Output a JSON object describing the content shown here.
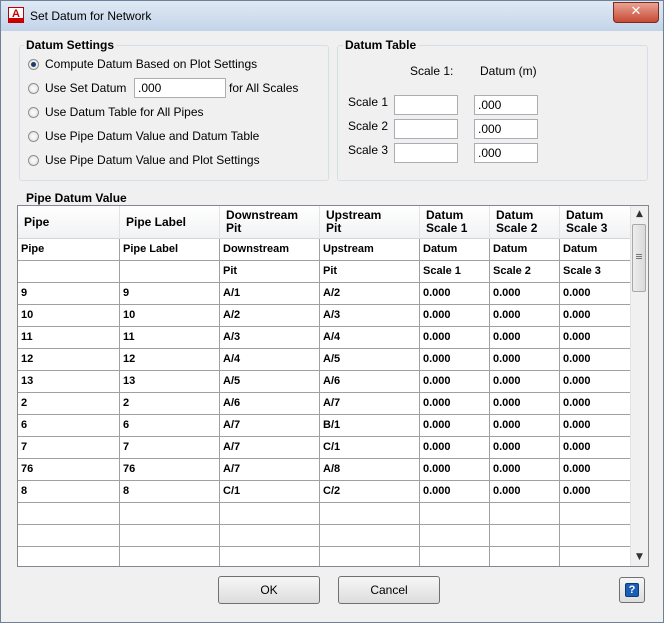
{
  "window": {
    "title": "Set Datum for Network",
    "app_icon_letter": "A",
    "close_glyph": "✕"
  },
  "datum_settings": {
    "title": "Datum Settings",
    "options": [
      {
        "label": "Compute Datum Based on Plot Settings",
        "checked": true
      },
      {
        "label": "Use Set Datum",
        "checked": false
      },
      {
        "label": "Use Datum Table for All Pipes",
        "checked": false
      },
      {
        "label": "Use Pipe Datum Value and Datum Table",
        "checked": false
      },
      {
        "label": "Use Pipe Datum Value and Plot Settings",
        "checked": false
      }
    ],
    "set_datum_value": ".000",
    "for_all_scales": "for All Scales"
  },
  "datum_table": {
    "title": "Datum Table",
    "col_scale": "Scale 1:",
    "col_datum": "Datum (m)",
    "rows": [
      {
        "label": "Scale 1",
        "scale": "",
        "datum": ".000"
      },
      {
        "label": "Scale 2",
        "scale": "",
        "datum": ".000"
      },
      {
        "label": "Scale 3",
        "scale": "",
        "datum": ".000"
      }
    ]
  },
  "pipe_datum": {
    "title": "Pipe Datum Value",
    "headers": [
      [
        "Pipe",
        ""
      ],
      [
        "Pipe Label",
        ""
      ],
      [
        "Downstream",
        "Pit"
      ],
      [
        "Upstream",
        "Pit"
      ],
      [
        "Datum",
        "Scale 1"
      ],
      [
        "Datum",
        "Scale 2"
      ],
      [
        "Datum",
        "Scale 3"
      ]
    ],
    "rows": [
      [
        "Pipe",
        "Pipe Label",
        "Downstream",
        "Upstream",
        "Datum",
        "Datum",
        "Datum"
      ],
      [
        "",
        "",
        "Pit",
        "Pit",
        "Scale 1",
        "Scale 2",
        "Scale 3"
      ],
      [
        "9",
        "9",
        "A/1",
        "A/2",
        "0.000",
        "0.000",
        "0.000"
      ],
      [
        "10",
        "10",
        "A/2",
        "A/3",
        "0.000",
        "0.000",
        "0.000"
      ],
      [
        "11",
        "11",
        "A/3",
        "A/4",
        "0.000",
        "0.000",
        "0.000"
      ],
      [
        "12",
        "12",
        "A/4",
        "A/5",
        "0.000",
        "0.000",
        "0.000"
      ],
      [
        "13",
        "13",
        "A/5",
        "A/6",
        "0.000",
        "0.000",
        "0.000"
      ],
      [
        "2",
        "2",
        "A/6",
        "A/7",
        "0.000",
        "0.000",
        "0.000"
      ],
      [
        "6",
        "6",
        "A/7",
        "B/1",
        "0.000",
        "0.000",
        "0.000"
      ],
      [
        "7",
        "7",
        "A/7",
        "C/1",
        "0.000",
        "0.000",
        "0.000"
      ],
      [
        "76",
        "76",
        "A/7",
        "A/8",
        "0.000",
        "0.000",
        "0.000"
      ],
      [
        "8",
        "8",
        "C/1",
        "C/2",
        "0.000",
        "0.000",
        "0.000"
      ],
      [
        "",
        "",
        "",
        "",
        "",
        "",
        ""
      ],
      [
        "",
        "",
        "",
        "",
        "",
        "",
        ""
      ],
      [
        "",
        "",
        "",
        "",
        "",
        "",
        ""
      ]
    ],
    "scroll_up": "▲",
    "scroll_down": "▼"
  },
  "buttons": {
    "ok": "OK",
    "cancel": "Cancel",
    "help_glyph": "?"
  }
}
